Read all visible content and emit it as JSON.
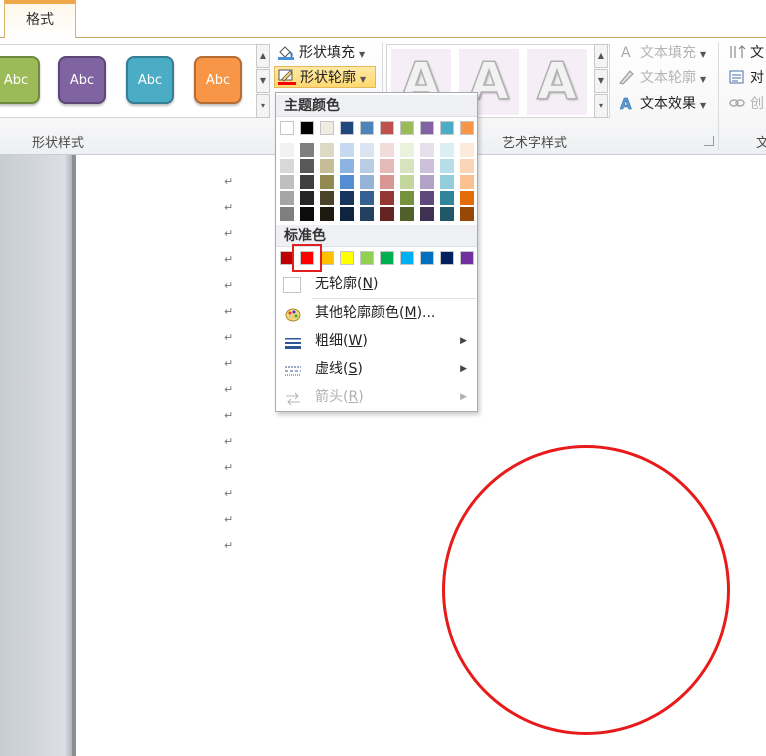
{
  "ribbon": {
    "tab_label": "格式",
    "shape_styles": {
      "group_label": "形状样式",
      "gallery": [
        {
          "label": "Abc",
          "fill": "#9bbb59",
          "border": "#71893f"
        },
        {
          "label": "Abc",
          "fill": "#8064a2",
          "border": "#5c4776"
        },
        {
          "label": "Abc",
          "fill": "#4bacc6",
          "border": "#357d91"
        },
        {
          "label": "Abc",
          "fill": "#f79646",
          "border": "#b66d31"
        }
      ],
      "fill_label": "形状填充",
      "outline_label": "形状轮廓"
    },
    "wordart": {
      "group_label": "艺术字样式",
      "gallery": [
        "A",
        "A",
        "A"
      ],
      "text_fill": "文本填充",
      "text_outline": "文本轮廓",
      "text_effects": "文本效果"
    },
    "text_group": {
      "cut_label": "文",
      "align_label": "对",
      "link_label": "创"
    }
  },
  "dropdown": {
    "theme_colors_title": "主题颜色",
    "theme_row": [
      "#ffffff",
      "#000000",
      "#eeece1",
      "#1f497d",
      "#4f81bd",
      "#c0504d",
      "#9bbb59",
      "#8064a2",
      "#4bacc6",
      "#f79646"
    ],
    "shade_columns": [
      [
        "#f2f2f2",
        "#d8d8d8",
        "#bfbfbf",
        "#a5a5a5",
        "#7f7f7f"
      ],
      [
        "#7f7f7f",
        "#595959",
        "#3f3f3f",
        "#262626",
        "#0c0c0c"
      ],
      [
        "#ddd9c3",
        "#c4bd97",
        "#938953",
        "#494429",
        "#1d1b10"
      ],
      [
        "#c6d9f0",
        "#8db3e2",
        "#548dd4",
        "#17365d",
        "#0f243e"
      ],
      [
        "#dbe5f1",
        "#b8cce4",
        "#95b3d7",
        "#366092",
        "#244061"
      ],
      [
        "#f2dcdb",
        "#e5b9b7",
        "#d99694",
        "#953734",
        "#632423"
      ],
      [
        "#ebf1dd",
        "#d7e3bc",
        "#c3d69b",
        "#76923c",
        "#4f6128"
      ],
      [
        "#e5e0ec",
        "#ccc1d9",
        "#b2a2c7",
        "#5f497a",
        "#3f3151"
      ],
      [
        "#dbeef3",
        "#b7dde8",
        "#92cddc",
        "#31859b",
        "#205867"
      ],
      [
        "#fdeada",
        "#fbd5b5",
        "#fac08f",
        "#e36c09",
        "#974806"
      ]
    ],
    "standard_colors_title": "标准色",
    "standard_colors": [
      "#c00000",
      "#ff0000",
      "#ffc000",
      "#ffff00",
      "#92d050",
      "#00b050",
      "#00b0f0",
      "#0070c0",
      "#002060",
      "#7030a0"
    ],
    "selected_standard_index": 1,
    "no_outline": {
      "text": "无轮廓(",
      "key": "N",
      "suffix": ")"
    },
    "more_colors": {
      "text": "其他轮廓颜色(",
      "key": "M",
      "suffix": ")..."
    },
    "weight": {
      "text": "粗细(",
      "key": "W",
      "suffix": ")"
    },
    "dashes": {
      "text": "虚线(",
      "key": "S",
      "suffix": ")"
    },
    "arrows": {
      "text": "箭头(",
      "key": "R",
      "suffix": ")"
    }
  },
  "document": {
    "paragraph_mark": "↵",
    "paragraph_count": 15,
    "shape_outline_color": "#e81a1a"
  }
}
